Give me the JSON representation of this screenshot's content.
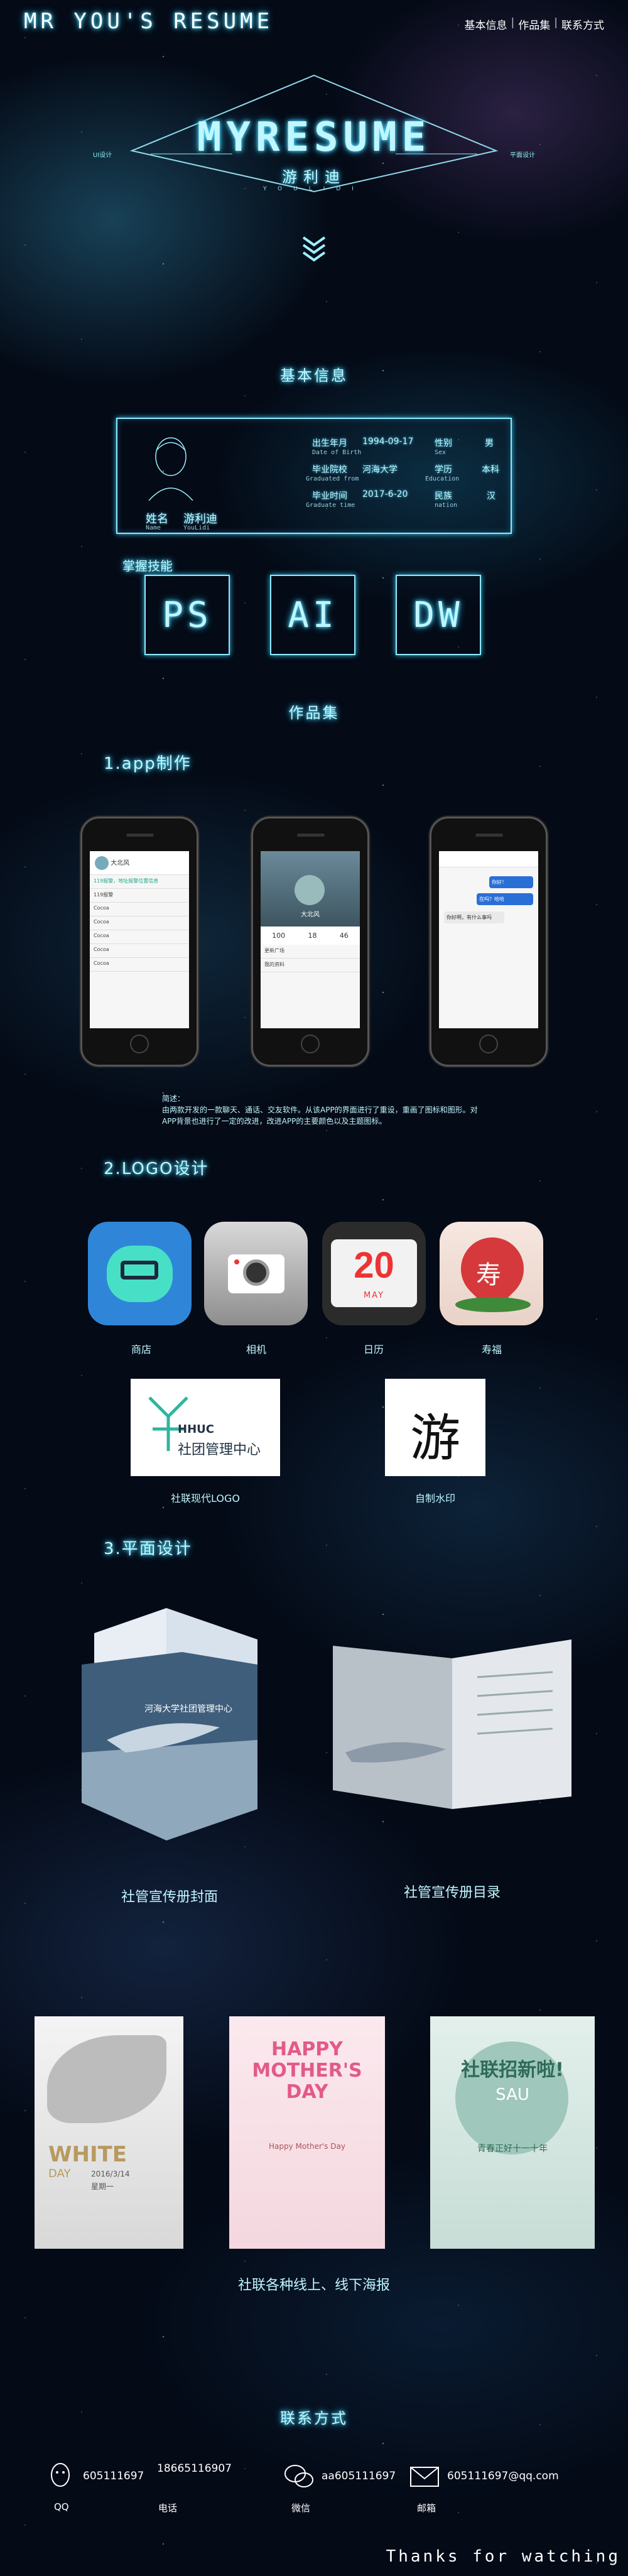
{
  "header": {
    "brand": "MR YOU'S RESUME",
    "nav": [
      "基本信息",
      "作品集",
      "联系方式"
    ]
  },
  "hero": {
    "title": "MYRESUME",
    "subtitle": "游利迪",
    "tiny": "YOULIDI",
    "tag_left": "UI设计",
    "tag_right": "平面设计"
  },
  "basic": {
    "section_title": "基本信息",
    "birth_label": "出生年月",
    "birth_value": "1994-09-17",
    "birth_en": "Date of Birth",
    "sex_label": "性别",
    "sex_value": "男",
    "sex_en": "Sex",
    "grad_label": "毕业院校",
    "grad_value": "河海大学",
    "grad_en": "Graduated from",
    "edu_label": "学历",
    "edu_value": "本科",
    "edu_en": "Education",
    "gtime_label": "毕业时间",
    "gtime_value": "2017-6-20",
    "gtime_en": "Graduate time",
    "nation_label": "民族",
    "nation_value": "汉",
    "nation_en": "nation",
    "name_label": "姓名",
    "name_value": "游利迪",
    "name_en": "Name",
    "name_en_value": "YouLidi",
    "skills_title": "掌握技能",
    "skills": [
      "PS",
      "AI",
      "DW"
    ]
  },
  "works": {
    "section_title": "作品集",
    "app_heading": "1.app制作",
    "app_desc": "简述：\n由两款开发的一款聊天、通话、交友软件。从该APP的界面进行了重设，重画了图标和图形。对APP背景也进行了一定的改进，改进APP的主要颜色以及主题图标。",
    "phone1": {
      "user": "大北风",
      "rows": [
        "119报警",
        "Cocoa",
        "Cocoa",
        "Cocoa",
        "Cocoa",
        "Cocoa"
      ],
      "highlight": "119报警，地址报警位置信息"
    },
    "phone2": {
      "name": "大北风",
      "stats": [
        "100",
        "18",
        "46"
      ],
      "items": [
        "更新广场",
        "我的资料"
      ]
    },
    "phone3": {
      "bubbles": [
        "你好！",
        "在吗？哈哈",
        "你好啊，有什么事吗"
      ]
    },
    "logo_heading": "2.LOGO设计",
    "app_icons": [
      {
        "label": "商店",
        "color": "#2f86d8"
      },
      {
        "label": "相机",
        "color": "#9a9a9a"
      },
      {
        "label": "日历",
        "color": "#2b2b2b"
      },
      {
        "label": "寿福",
        "color": "#d5393b"
      }
    ],
    "calendar_num": "20",
    "calendar_month": "MAY",
    "shou_char": "寿",
    "logos": [
      {
        "label": "社联现代LOGO",
        "text_en": "HHUC",
        "text_cn": "社团管理中心"
      },
      {
        "label": "自制水印",
        "text_cn": "游"
      }
    ],
    "print_heading": "3.平面设计",
    "brochures": [
      {
        "label": "社管宣传册封面",
        "cover_text": "河海大学社团管理中心"
      },
      {
        "label": "社管宣传册目录"
      }
    ],
    "posters_label": "社联各种线上、线下海报",
    "posters": [
      {
        "title": "WHITE",
        "subtitle": "DAY",
        "date": "2016/3/14",
        "note": "星期一"
      },
      {
        "title": "HAPPY MOTHER'S DAY",
        "line": "Happy Mother's Day"
      },
      {
        "title": "社联招新啦!",
        "subtitle": "SAU",
        "line": "青春正好十一十年"
      }
    ]
  },
  "contact": {
    "section_title": "联系方式",
    "items": [
      {
        "value": "605111697",
        "label": "QQ"
      },
      {
        "value": "18665116907",
        "label": "电话"
      },
      {
        "value": "aa605111697",
        "label": "微信"
      },
      {
        "value": "605111697@qq.com",
        "label": "邮箱"
      }
    ],
    "thanks": "Thanks for watching"
  }
}
